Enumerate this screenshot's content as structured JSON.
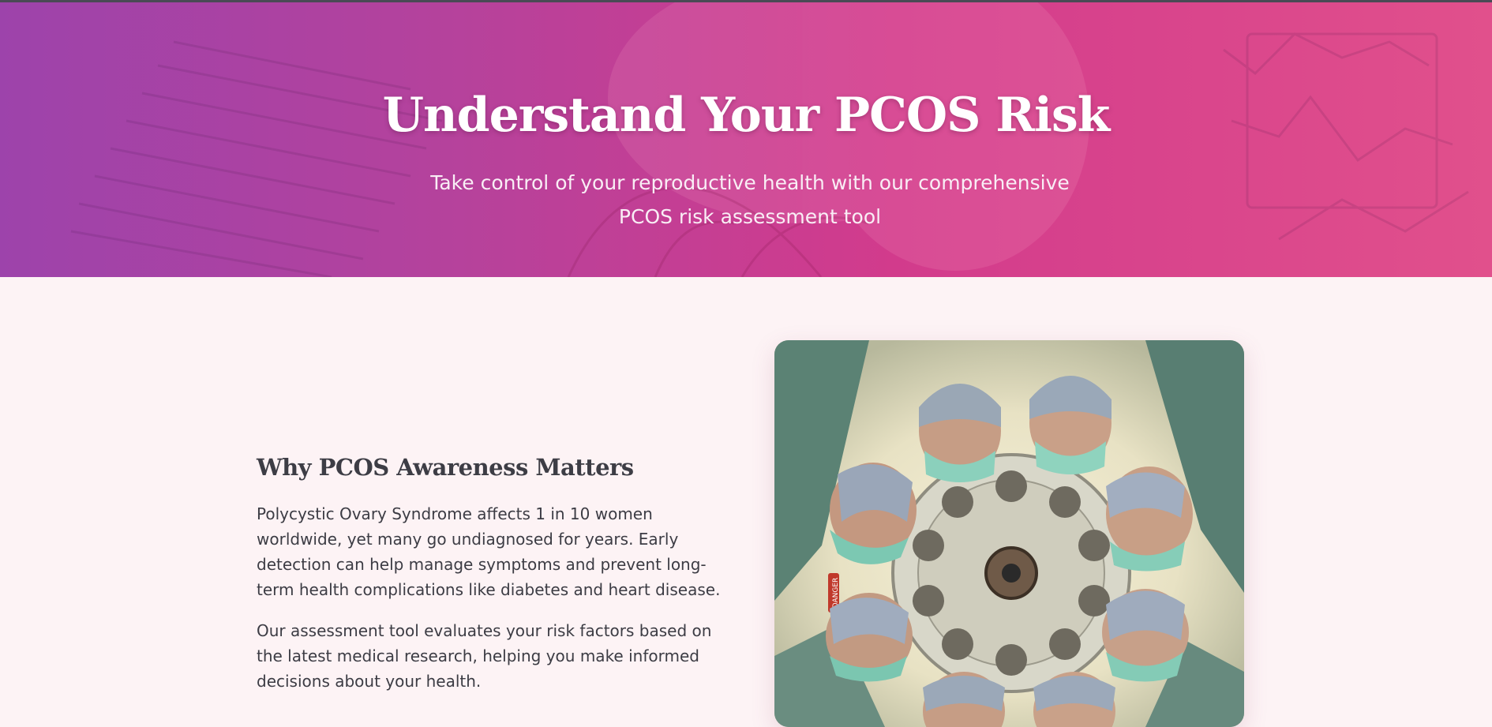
{
  "hero": {
    "title": "Understand Your PCOS Risk",
    "subtitle_line1": "Take control of your reproductive health with our comprehensive",
    "subtitle_line2": "PCOS risk assessment tool",
    "colors": {
      "gradient_start": "#9d43ab",
      "gradient_end": "#e1508c"
    }
  },
  "awareness": {
    "heading": "Why PCOS Awareness Matters",
    "paragraph1": "Polycystic Ovary Syndrome affects 1 in 10 women worldwide, yet many go undiagnosed for years. Early detection can help manage symptoms and prevent long-term health complications like diabetes and heart disease.",
    "paragraph2": "Our assessment tool evaluates your risk factors based on the latest medical research, helping you make informed decisions about your health."
  },
  "image": {
    "subject": "surgical team looking down under operating light",
    "sign_text": "DANGER"
  },
  "colors": {
    "page_background": "#fdf3f5",
    "body_text": "#3c3c44",
    "heading_text": "#3d3d45"
  }
}
